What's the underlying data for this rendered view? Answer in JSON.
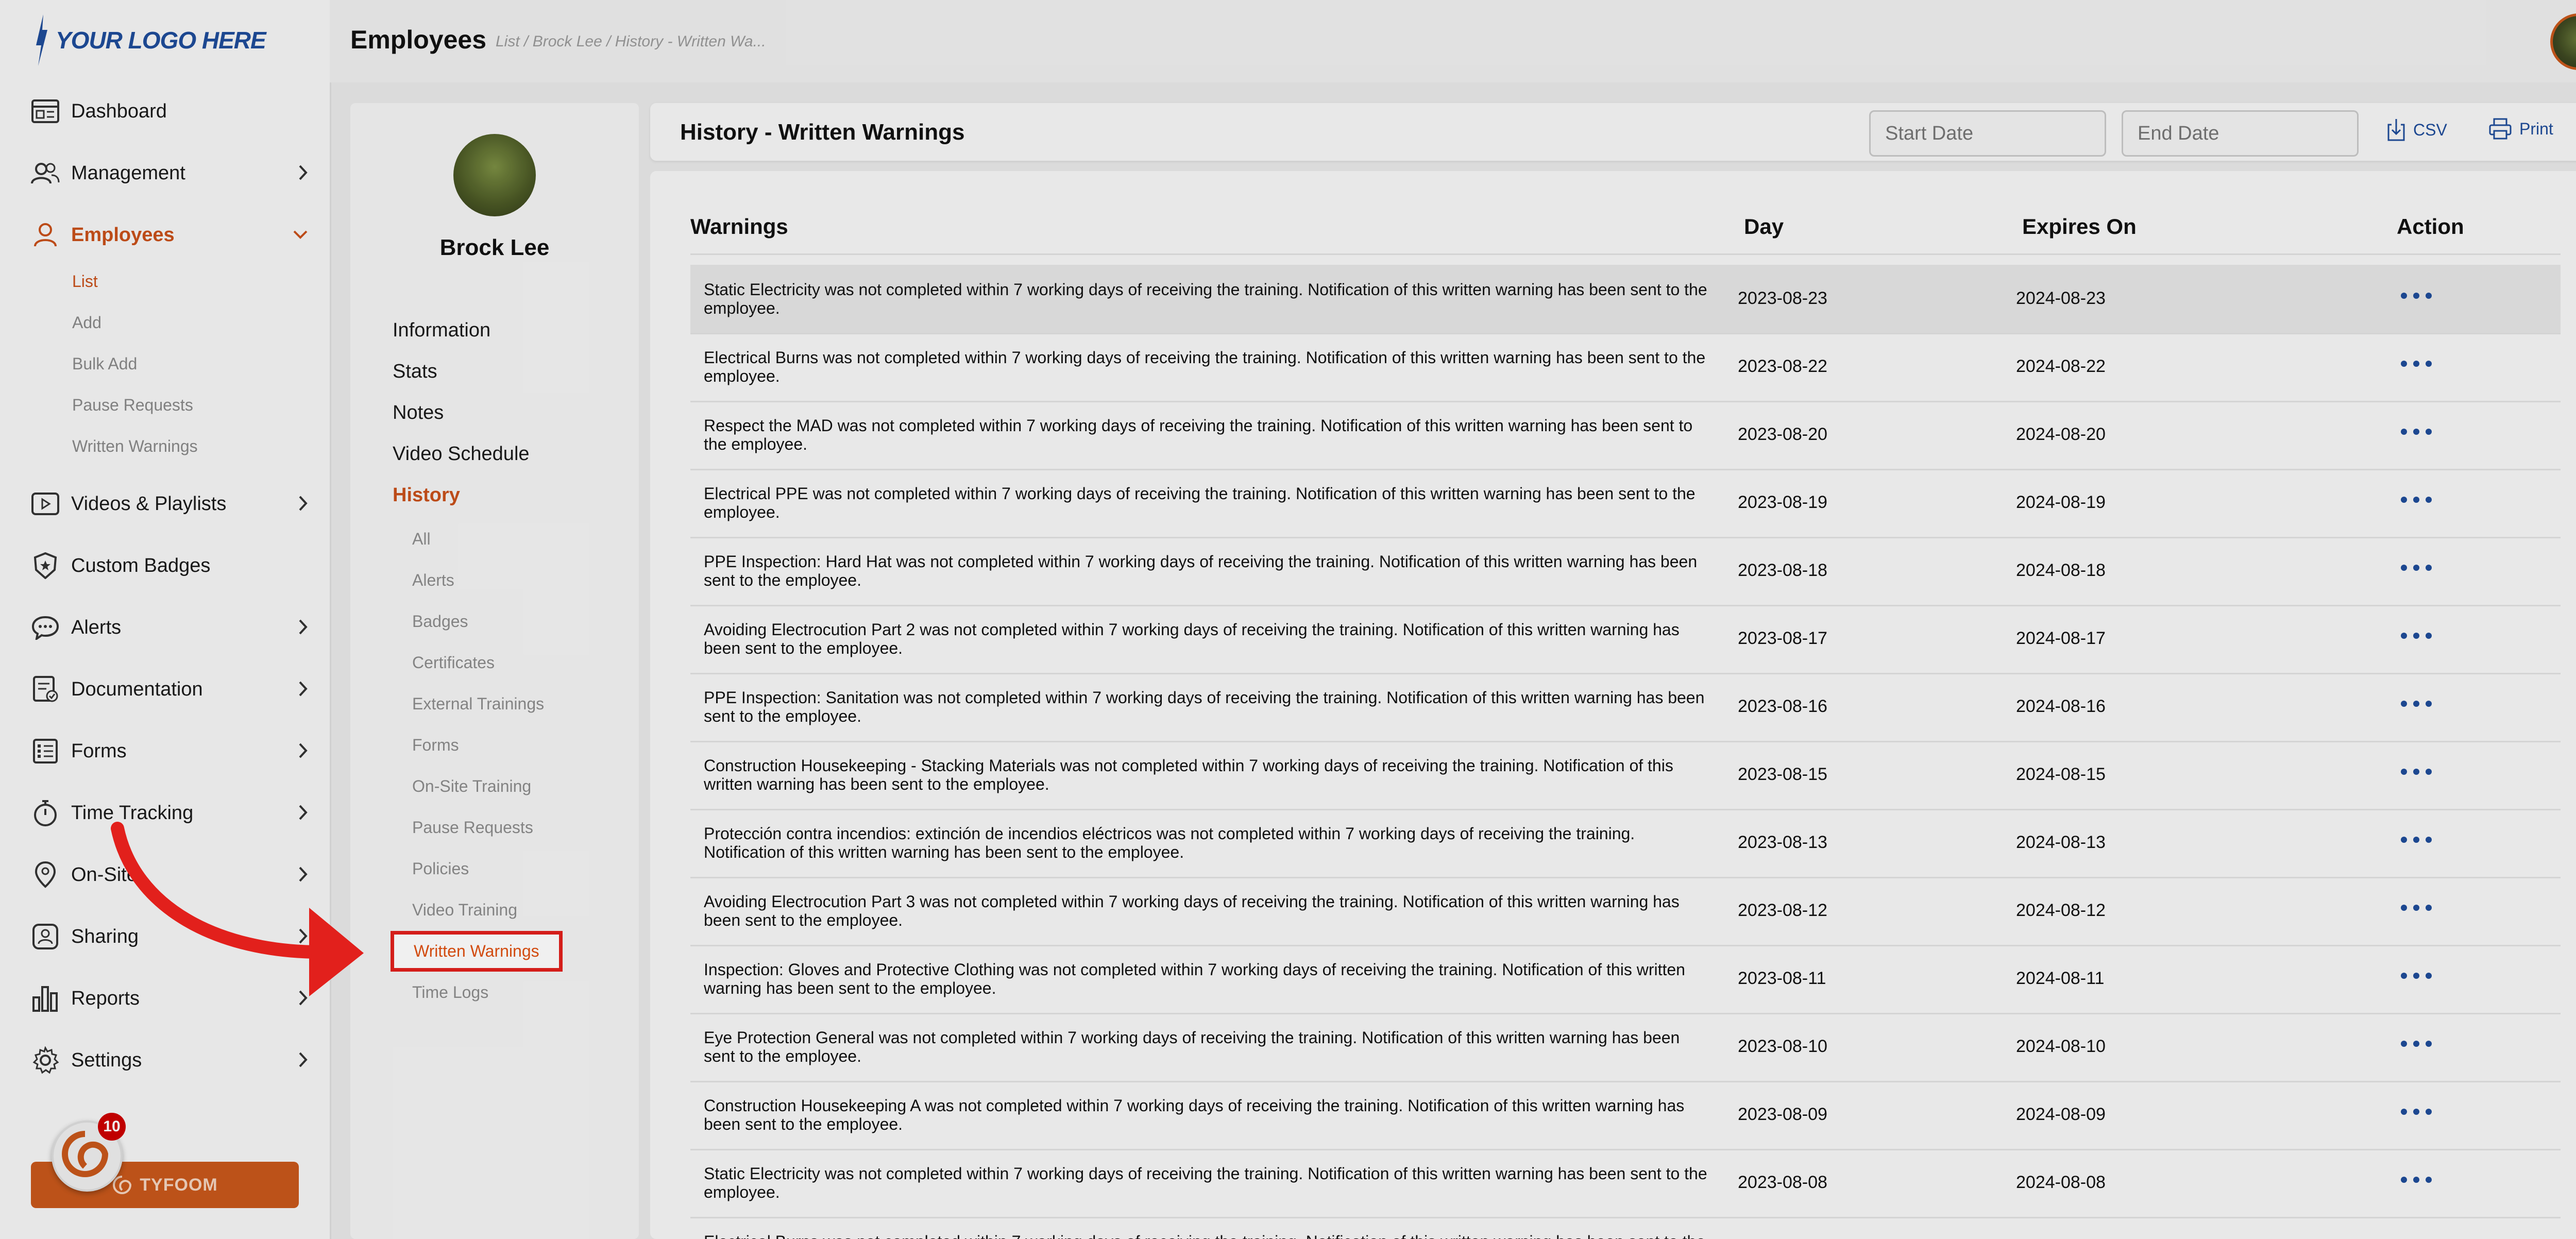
{
  "logo": {
    "text": "YOUR LOGO HERE"
  },
  "sidebar": {
    "items": [
      {
        "label": "Dashboard",
        "icon": "dashboard-icon"
      },
      {
        "label": "Management",
        "icon": "users-icon"
      },
      {
        "label": "Employees",
        "icon": "person-icon",
        "active": true
      },
      {
        "label": "Videos & Playlists",
        "icon": "video-icon"
      },
      {
        "label": "Custom Badges",
        "icon": "badge-icon"
      },
      {
        "label": "Alerts",
        "icon": "chat-icon"
      },
      {
        "label": "Documentation",
        "icon": "document-icon"
      },
      {
        "label": "Forms",
        "icon": "list-icon"
      },
      {
        "label": "Time Tracking",
        "icon": "stopwatch-icon"
      },
      {
        "label": "On-Site",
        "icon": "location-pin-icon"
      },
      {
        "label": "Sharing",
        "icon": "share-person-icon"
      },
      {
        "label": "Reports",
        "icon": "bar-chart-icon"
      },
      {
        "label": "Settings",
        "icon": "gear-icon"
      }
    ],
    "employee_sub": [
      "List",
      "Add",
      "Bulk Add",
      "Pause Requests",
      "Written Warnings"
    ],
    "promo": {
      "label": "TYFOOM",
      "badge_count": "10"
    }
  },
  "header": {
    "title": "Employees",
    "breadcrumb": "List  /  Brock Lee  /  History - Written Wa..."
  },
  "profile": {
    "name": "Brock Lee",
    "nav": [
      "Information",
      "Stats",
      "Notes",
      "Video Schedule",
      "History"
    ],
    "history_sub": [
      "All",
      "Alerts",
      "Badges",
      "Certificates",
      "External Trainings",
      "Forms",
      "On-Site Training",
      "Pause Requests",
      "Policies",
      "Video Training",
      "Written Warnings",
      "Time Logs"
    ]
  },
  "toolbar": {
    "title": "History - Written Warnings",
    "start_placeholder": "Start Date",
    "end_placeholder": "End Date",
    "csv_label": "CSV",
    "print_label": "Print"
  },
  "table": {
    "headers": {
      "warnings": "Warnings",
      "day": "Day",
      "expires": "Expires On",
      "action": "Action"
    },
    "rows": [
      {
        "desc": "Static Electricity was not completed within 7 working days of receiving the training. Notification of this written warning has been sent to the employee.",
        "day": "2023-08-23",
        "expires": "2024-08-23"
      },
      {
        "desc": "Electrical Burns was not completed within 7 working days of receiving the training. Notification of this written warning has been sent to the employee.",
        "day": "2023-08-22",
        "expires": "2024-08-22"
      },
      {
        "desc": "Respect the MAD was not completed within 7 working days of receiving the training. Notification of this written warning has been sent to the employee.",
        "day": "2023-08-20",
        "expires": "2024-08-20"
      },
      {
        "desc": "Electrical PPE was not completed within 7 working days of receiving the training. Notification of this written warning has been sent to the employee.",
        "day": "2023-08-19",
        "expires": "2024-08-19"
      },
      {
        "desc": "PPE Inspection: Hard Hat was not completed within 7 working days of receiving the training. Notification of this written warning has been sent to the employee.",
        "day": "2023-08-18",
        "expires": "2024-08-18"
      },
      {
        "desc": "Avoiding Electrocution Part 2 was not completed within 7 working days of receiving the training. Notification of this written warning has been sent to the employee.",
        "day": "2023-08-17",
        "expires": "2024-08-17"
      },
      {
        "desc": "PPE Inspection: Sanitation was not completed within 7 working days of receiving the training. Notification of this written warning has been sent to the employee.",
        "day": "2023-08-16",
        "expires": "2024-08-16"
      },
      {
        "desc": "Construction Housekeeping - Stacking Materials was not completed within 7 working days of receiving the training. Notification of this written warning has been sent to the employee.",
        "day": "2023-08-15",
        "expires": "2024-08-15"
      },
      {
        "desc": "Protección contra incendios: extinción de incendios eléctricos was not completed within 7 working days of receiving the training. Notification of this written warning has been sent to the employee.",
        "day": "2023-08-13",
        "expires": "2024-08-13"
      },
      {
        "desc": "Avoiding Electrocution Part 3 was not completed within 7 working days of receiving the training. Notification of this written warning has been sent to the employee.",
        "day": "2023-08-12",
        "expires": "2024-08-12"
      },
      {
        "desc": "Inspection: Gloves and Protective Clothing was not completed within 7 working days of receiving the training. Notification of this written warning has been sent to the employee.",
        "day": "2023-08-11",
        "expires": "2024-08-11"
      },
      {
        "desc": "Eye Protection General was not completed within 7 working days of receiving the training. Notification of this written warning has been sent to the employee.",
        "day": "2023-08-10",
        "expires": "2024-08-10"
      },
      {
        "desc": "Construction Housekeeping A was not completed within 7 working days of receiving the training. Notification of this written warning has been sent to the employee.",
        "day": "2023-08-09",
        "expires": "2024-08-09"
      },
      {
        "desc": "Static Electricity was not completed within 7 working days of receiving the training. Notification of this written warning has been sent to the employee.",
        "day": "2023-08-08",
        "expires": "2024-08-08"
      },
      {
        "desc": "Electrical Burns was not completed within 7 working days of receiving the training. Notification of this written warning has been sent to the employee.",
        "day": "",
        "expires": ""
      }
    ]
  },
  "colors": {
    "accent": "#c8501a",
    "link": "#1e4c9a",
    "highlight": "#e2201c"
  }
}
